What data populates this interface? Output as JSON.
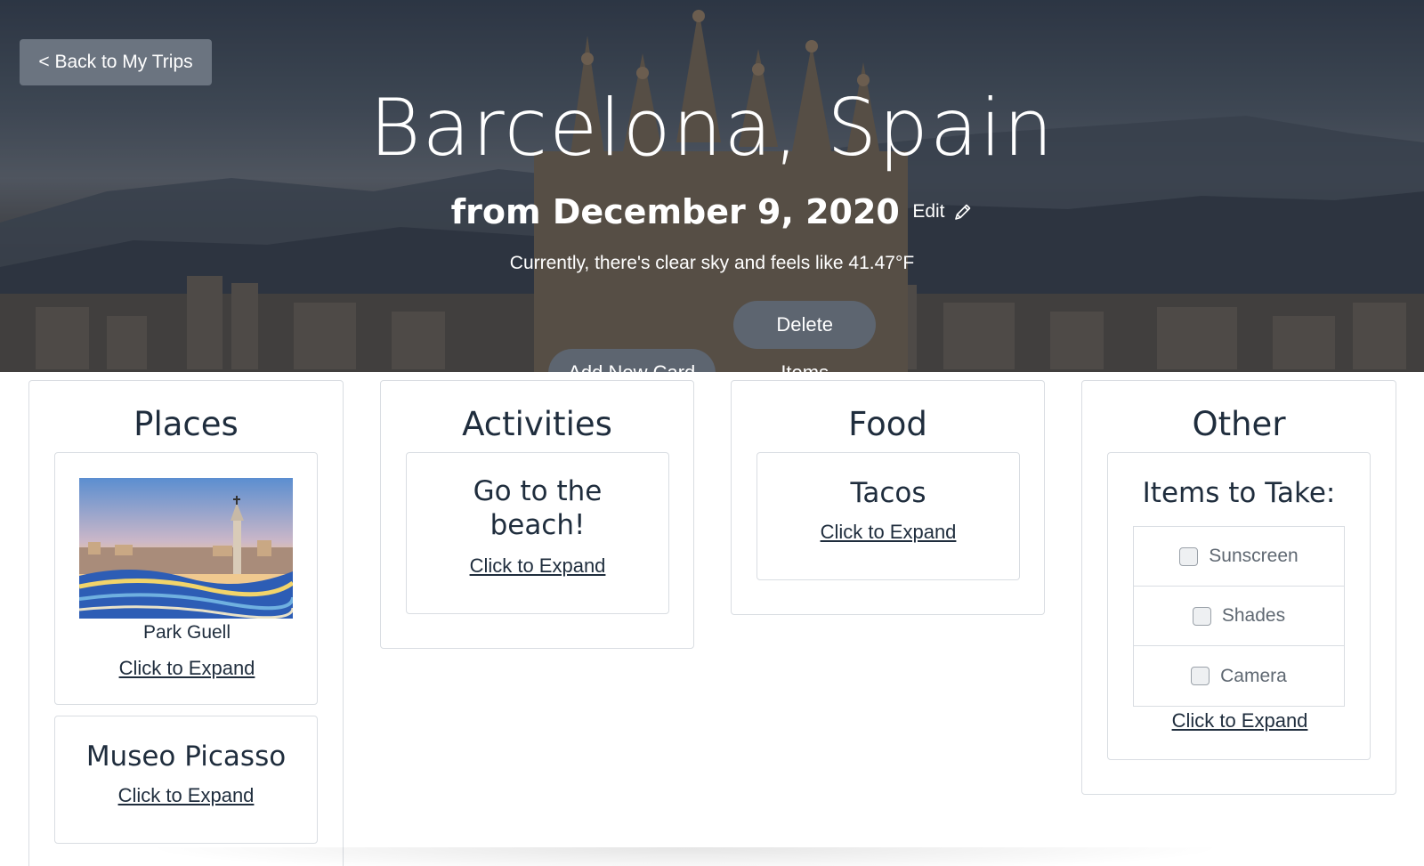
{
  "hero": {
    "back_label": "< Back to My Trips",
    "title": "Barcelona, Spain",
    "dates": "from December 9, 2020",
    "edit_label": "Edit",
    "weather": "Currently, there's clear sky and feels like 41.47°F",
    "add_card_label": "Add New Card",
    "delete_items_label": "Delete Items"
  },
  "columns": {
    "places": {
      "title": "Places",
      "cards": [
        {
          "caption": "Park Guell",
          "expand": "Click to Expand"
        },
        {
          "title": "Museo Picasso",
          "expand": "Click to Expand"
        }
      ]
    },
    "activities": {
      "title": "Activities",
      "cards": [
        {
          "title_line1": "Go to the",
          "title_line2": "beach!",
          "expand": "Click to Expand"
        }
      ]
    },
    "food": {
      "title": "Food",
      "cards": [
        {
          "title": "Tacos",
          "expand": "Click to Expand"
        }
      ]
    },
    "other": {
      "title": "Other",
      "cards": [
        {
          "title": "Items to Take:",
          "items": [
            "Sunscreen",
            "Shades",
            "Camera"
          ],
          "expand": "Click to Expand"
        }
      ]
    }
  },
  "colors": {
    "text": "#1f2d3d",
    "border": "#d9dde2",
    "button_bg": "#6b7480",
    "pill_bg": "#5d6570"
  },
  "icons": {
    "edit": "pencil-icon"
  }
}
